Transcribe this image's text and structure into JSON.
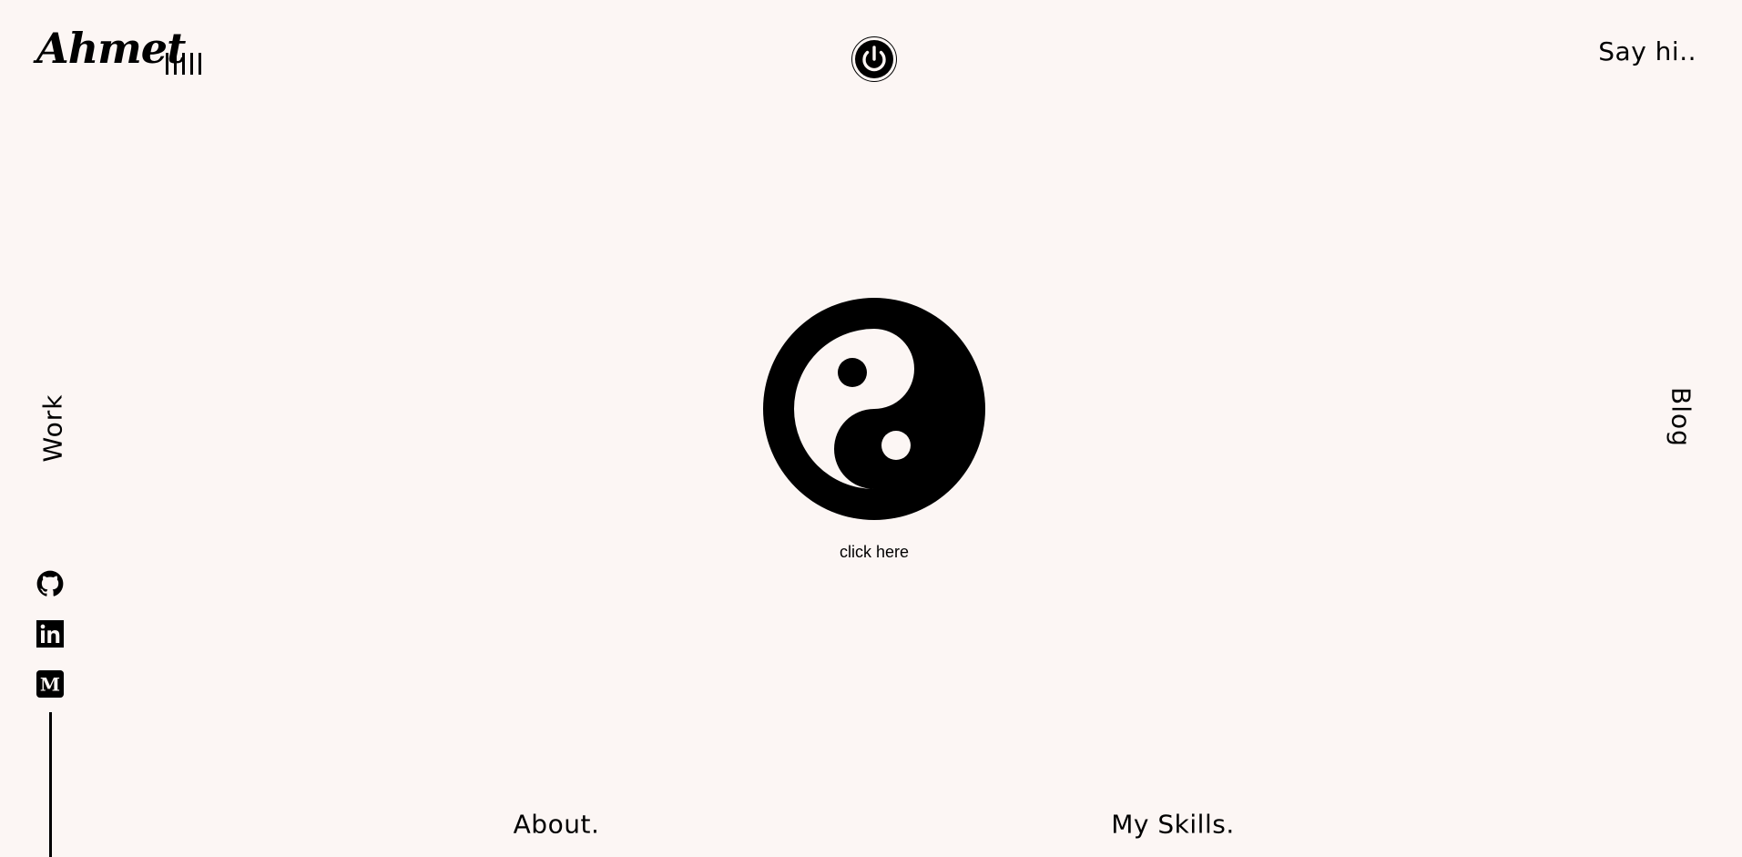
{
  "header": {
    "logo_text": "Ahmet",
    "menu_bars_count": 5,
    "say_hi_label": "Say hi.."
  },
  "center": {
    "click_label": "click here",
    "power_icon": "power-icon",
    "toggle_icon": "yin-yang-icon"
  },
  "side_nav": {
    "left_label": "Work",
    "right_label": "Blog"
  },
  "socials": [
    {
      "name": "github-icon"
    },
    {
      "name": "linkedin-icon"
    },
    {
      "name": "medium-icon"
    }
  ],
  "bottom_nav": {
    "about_label": "About.",
    "skills_label": "My Skills."
  },
  "colors": {
    "background": "#fcf6f4",
    "foreground": "#000000"
  }
}
